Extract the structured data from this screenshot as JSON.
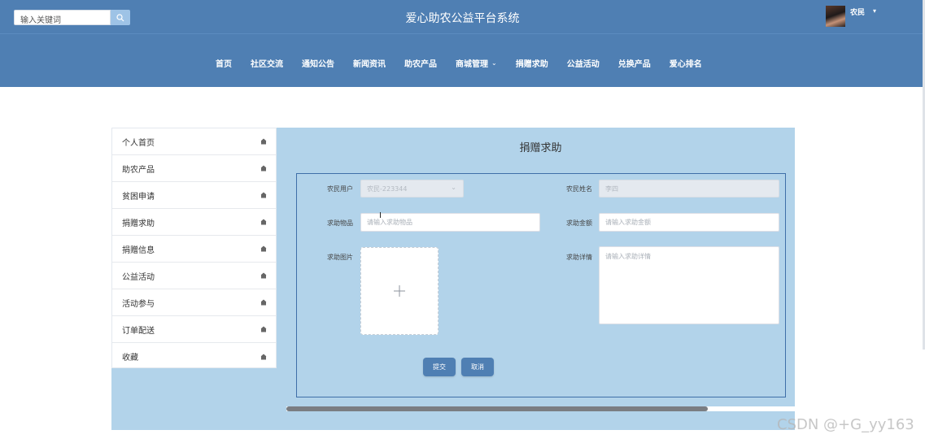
{
  "header": {
    "site_title": "爱心助农公益平台系统",
    "search_placeholder": "输入关键词",
    "user_name": "农民",
    "brand_color": "#4f7fb3"
  },
  "nav": {
    "items": [
      {
        "label": "首页"
      },
      {
        "label": "社区交流"
      },
      {
        "label": "通知公告"
      },
      {
        "label": "新闻资讯"
      },
      {
        "label": "助农产品"
      },
      {
        "label": "商城管理"
      },
      {
        "label": "捐赠求助"
      },
      {
        "label": "公益活动"
      },
      {
        "label": "兑换产品"
      },
      {
        "label": "爱心排名"
      }
    ]
  },
  "sidebar": {
    "items": [
      {
        "label": "个人首页"
      },
      {
        "label": "助农产品"
      },
      {
        "label": "贫困申请"
      },
      {
        "label": "捐赠求助"
      },
      {
        "label": "捐赠信息"
      },
      {
        "label": "公益活动"
      },
      {
        "label": "活动参与"
      },
      {
        "label": "订单配送"
      },
      {
        "label": "收藏"
      }
    ]
  },
  "form": {
    "title": "捐赠求助",
    "farmer_user_label": "农民用户",
    "farmer_user_value": "农民-223344",
    "farmer_name_label": "农民姓名",
    "farmer_name_value": "李四",
    "item_label": "求助物品",
    "item_placeholder": "请输入求助物品",
    "amount_label": "求助金额",
    "amount_placeholder": "请输入求助金额",
    "image_label": "求助图片",
    "detail_label": "求助详情",
    "detail_placeholder": "请输入求助详情",
    "submit_label": "提交",
    "cancel_label": "取消"
  },
  "watermark": "CSDN @+G_yy163"
}
